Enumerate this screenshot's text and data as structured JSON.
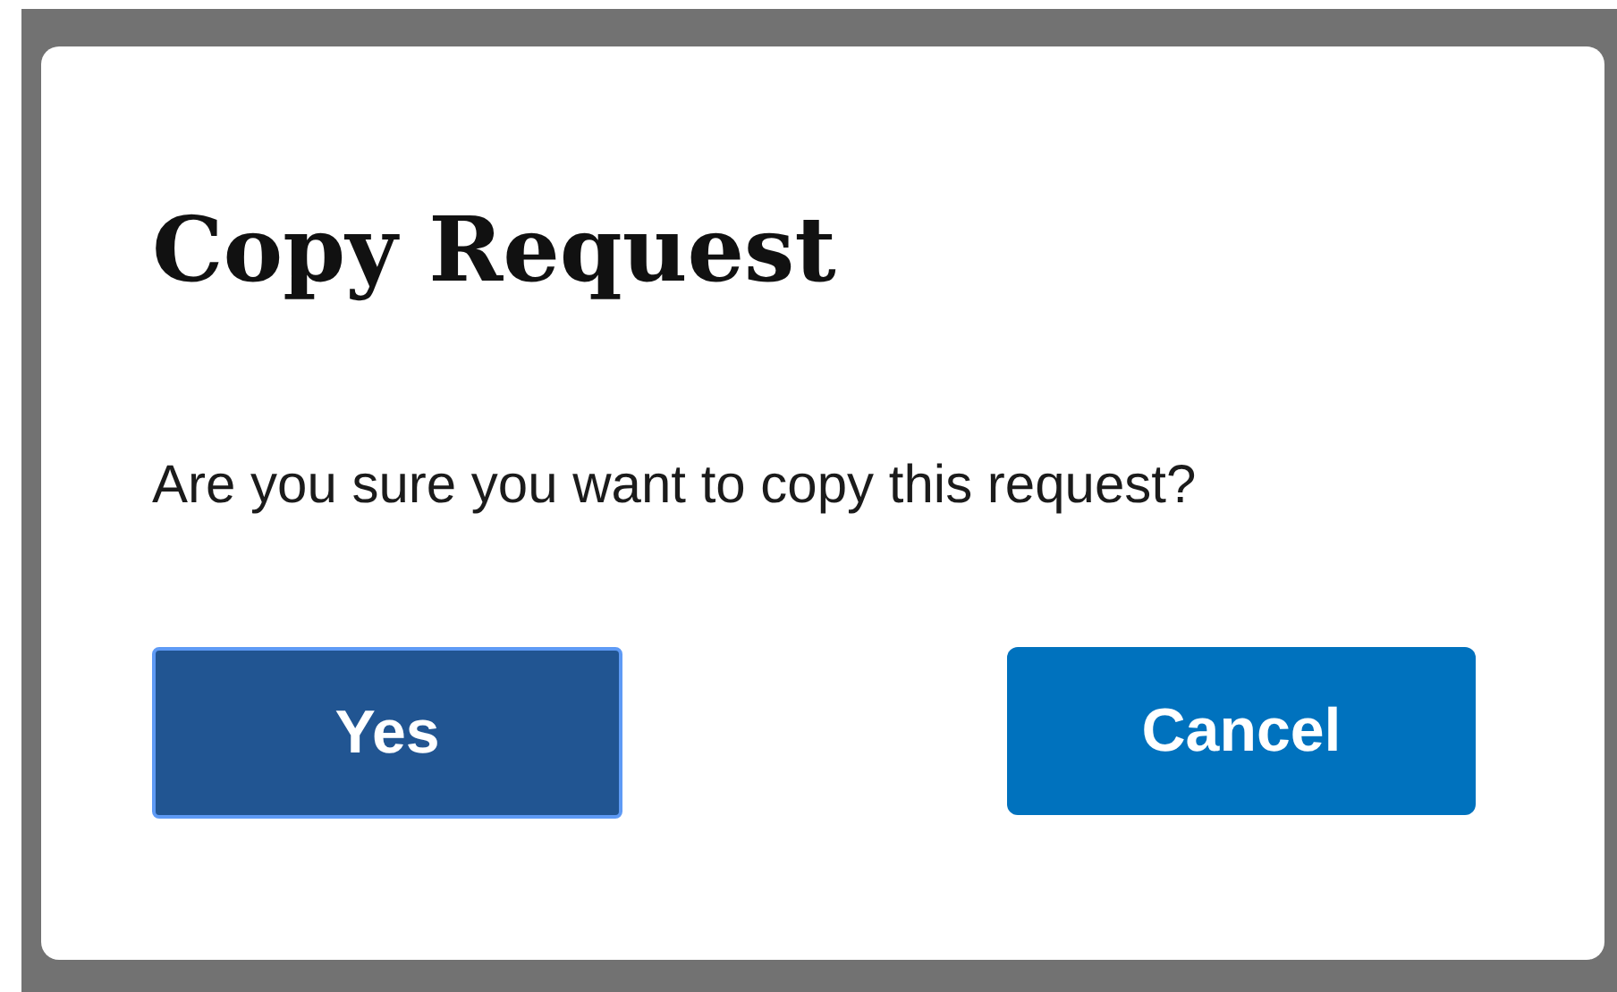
{
  "dialog": {
    "title": "Copy Request",
    "message": "Are you sure you want to copy this request?",
    "buttons": [
      {
        "label": "Yes",
        "focused": true
      },
      {
        "label": "Cancel",
        "focused": false
      }
    ]
  }
}
